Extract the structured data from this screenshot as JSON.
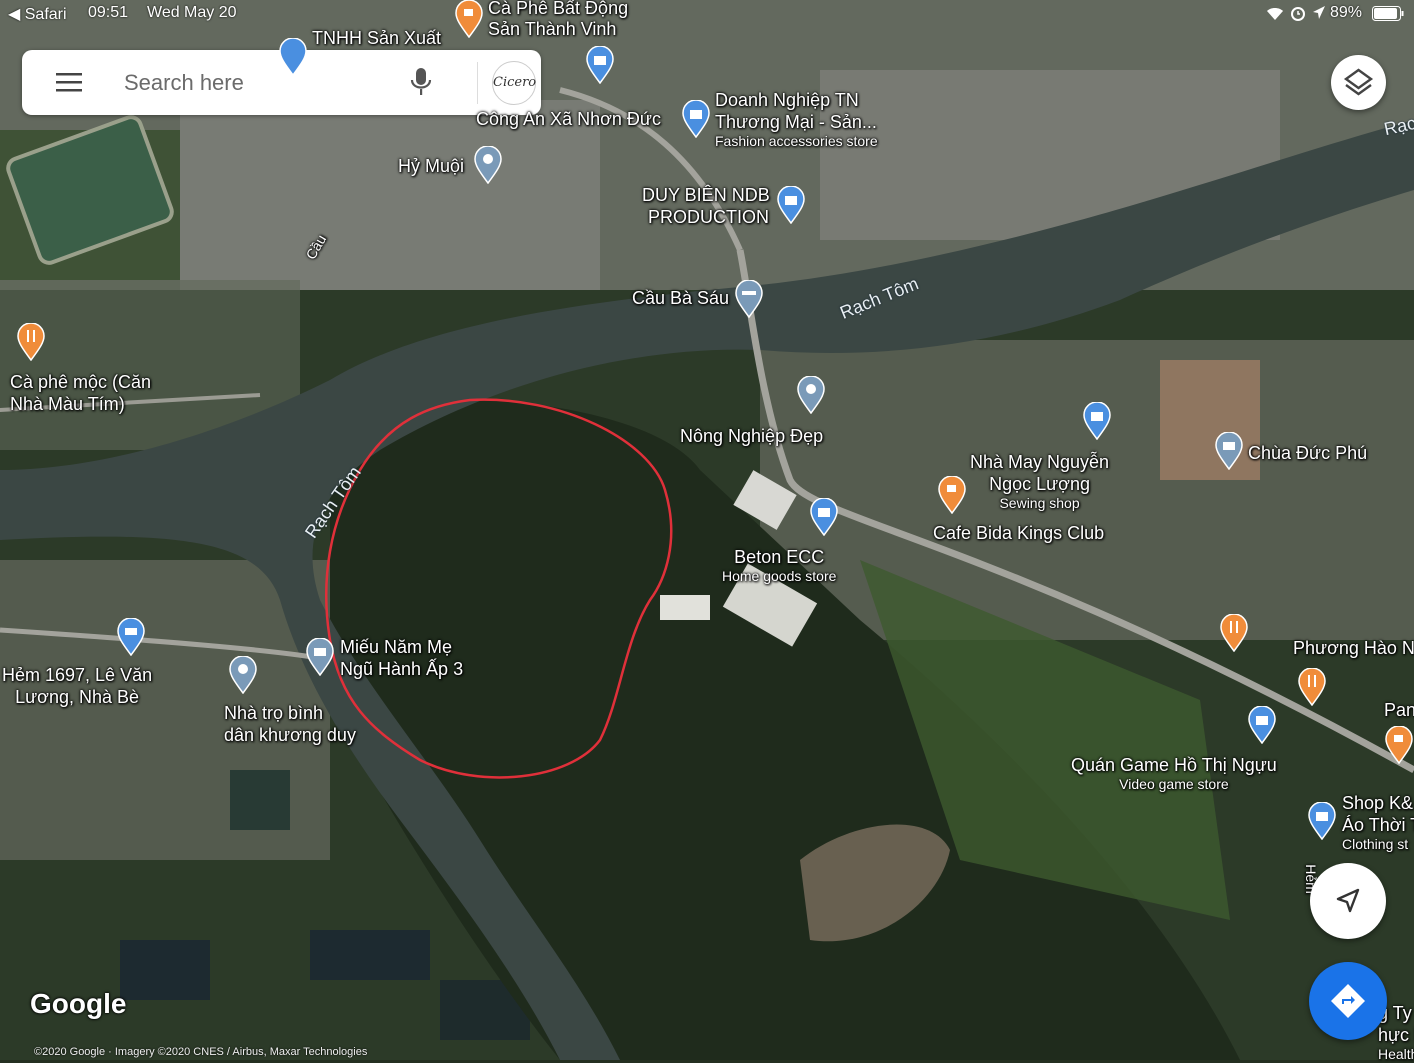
{
  "status_bar": {
    "back_app": "◀ Safari",
    "time": "09:51",
    "date": "Wed May 20",
    "battery": "89%"
  },
  "search": {
    "placeholder": "Search here",
    "avatar_text": "Cicero"
  },
  "map_labels": {
    "cafe_bat_dong_san": "Cà Phê Bất Động",
    "cafe_bat_dong_san_2": "Sản Thành Vinh",
    "tnhh_san_xuat": "TNHH Sản Xuất",
    "cong_an": "Công An Xã Nhơn Đức",
    "doanh_nghiep_1": "Doanh Nghiệp TN",
    "doanh_nghiep_2": "Thương Mại - Sản...",
    "doanh_nghiep_sub": "Fashion accessories store",
    "hy_muoi": "Hỷ Muội",
    "duy_bien_1": "DUY BIÊN NDB",
    "duy_bien_2": "PRODUCTION",
    "cau_ba_sau": "Cầu Bà Sáu",
    "cau_road": "Cầu",
    "rach_tom_1": "Rạch Tôm",
    "rach_tom_2": "Rạch Tôm",
    "rach_edge": "Rạc",
    "ca_phe_moc_1": "Cà phê mộc (Căn",
    "ca_phe_moc_2": "Nhà Màu Tím)",
    "nong_nghiep": "Nông Nghiệp Đẹp",
    "nha_may_1": "Nhà May Nguyễn",
    "nha_may_2": "Ngọc Lượng",
    "nha_may_sub": "Sewing shop",
    "chua_duc_phu": "Chùa Đức Phú",
    "cafe_bida": "Cafe Bida Kings Club",
    "beton": "Beton ECC",
    "beton_sub": "Home goods store",
    "mieu_1": "Miếu Năm Mẹ",
    "mieu_2": "Ngũ Hành Ấp 3",
    "hem_1": "Hẻm 1697, Lê Văn",
    "hem_2": "Lương, Nhà Bè",
    "nha_tro_1": "Nhà trọ bình",
    "nha_tro_2": "dân khương duy",
    "phuong_hao": "Phương Hào N",
    "pan": "Pan",
    "quan_game": "Quán Game Hồ Thị Ngựu",
    "quan_game_sub": "Video game store",
    "shop_1": "Shop K&",
    "shop_2": "Áo Thời T",
    "shop_sub": "Clothing st",
    "hem_vertical": "Hẻm",
    "cong_ty_1": "g Ty",
    "cong_ty_2": "hực Ph",
    "cong_ty_sub": "Health foo"
  },
  "google_logo": "Google",
  "copyright": "©2020 Google · Imagery ©2020 CNES / Airbus, Maxar Technologies",
  "colors": {
    "annotation_circle": "#e0303a",
    "pin_blue": "#4a8fe0",
    "pin_orange": "#f08c3a",
    "pin_grey": "#7a9ab8",
    "directions_blue": "#1a73e8"
  }
}
